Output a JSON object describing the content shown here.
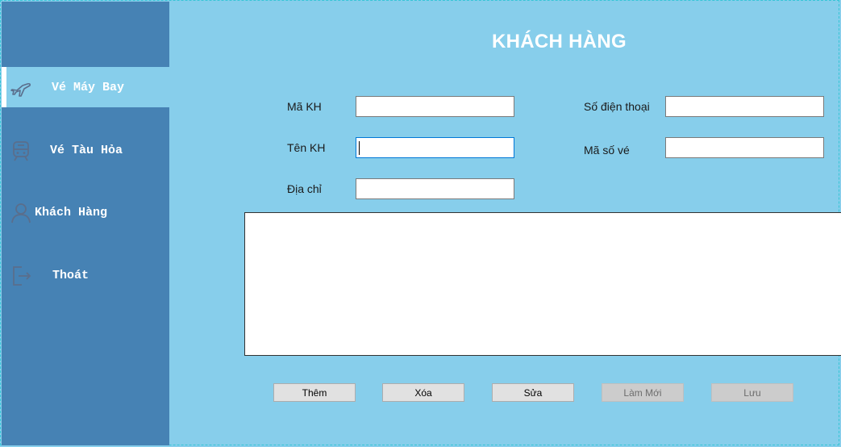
{
  "sidebar": {
    "items": [
      {
        "label": "Vé Máy Bay",
        "icon": "airplane-icon",
        "active": true
      },
      {
        "label": "Vé Tàu Hỏa",
        "icon": "train-icon",
        "active": false
      },
      {
        "label": "Khách Hàng",
        "icon": "user-icon",
        "active": false
      },
      {
        "label": "Thoát",
        "icon": "exit-icon",
        "active": false
      }
    ]
  },
  "main": {
    "title": "KHÁCH HÀNG",
    "fields": {
      "ma_kh": {
        "label": "Mã KH",
        "value": ""
      },
      "ten_kh": {
        "label": "Tên KH",
        "value": ""
      },
      "dia_chi": {
        "label": "Địa chỉ",
        "value": ""
      },
      "so_dien_thoai": {
        "label": "Số điện thoại",
        "value": ""
      },
      "ma_so_ve": {
        "label": "Mã số vé",
        "value": ""
      }
    },
    "buttons": {
      "them": "Thêm",
      "xoa": "Xóa",
      "sua": "Sửa",
      "lam_moi": "Làm Mới",
      "luu": "Lưu"
    }
  },
  "colors": {
    "sidebar": "#4682b4",
    "background": "#87ceeb",
    "icon": "#5a6e8c"
  }
}
